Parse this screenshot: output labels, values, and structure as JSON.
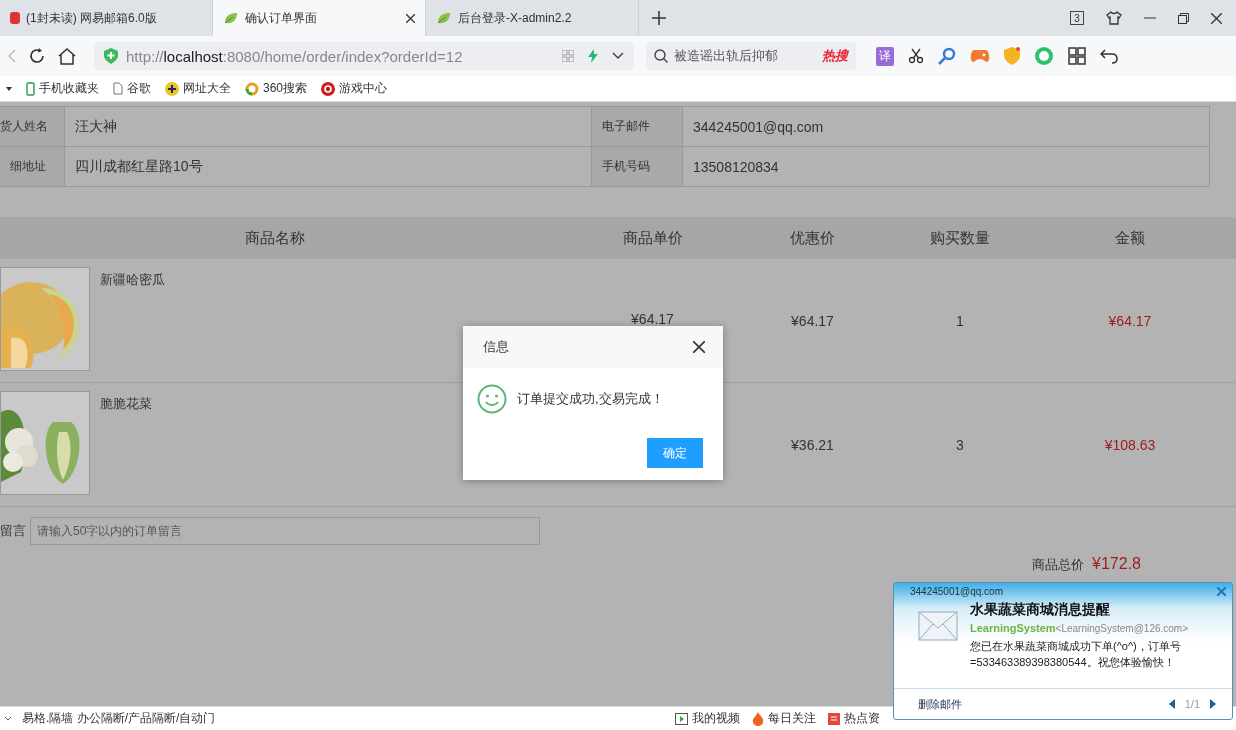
{
  "tabs": [
    {
      "label": "(1封未读) 网易邮箱6.0版",
      "kind": "mail",
      "selected": false
    },
    {
      "label": "确认订单界面",
      "kind": "leaf",
      "selected": true
    },
    {
      "label": "后台登录-X-admin2.2",
      "kind": "leaf",
      "selected": false
    }
  ],
  "tab_count": "3",
  "address_bar": {
    "scheme": "http://",
    "host": "localhost",
    "rest": ":8080/home/order/index?orderId=12"
  },
  "search": {
    "value": "被造谣出轨后抑郁",
    "hot_label": "热搜"
  },
  "translate_label": "译",
  "bookmarks": [
    {
      "label": "手机收藏夹",
      "kind": "phone"
    },
    {
      "label": "谷歌",
      "kind": "doc"
    },
    {
      "label": "网址大全",
      "kind": "plus"
    },
    {
      "label": "360搜索",
      "kind": "ring"
    },
    {
      "label": "游戏中心",
      "kind": "game"
    }
  ],
  "customer": [
    [
      {
        "label": "货人姓名",
        "value": "汪大神"
      },
      {
        "label": "电子邮件",
        "value": "344245001@qq.com"
      }
    ],
    [
      {
        "label": "细地址",
        "value": "四川成都红星路10号"
      },
      {
        "label": "手机号码",
        "value": "13508120834"
      }
    ]
  ],
  "products": {
    "columns": [
      "商品名称",
      "商品单价",
      "优惠价",
      "购买数量",
      "金额"
    ],
    "rows": [
      {
        "name": "新疆哈密瓜",
        "kind": "melon",
        "unit_price": "¥64.17",
        "discount_price": "¥64.17",
        "quantity": "1",
        "amount": "¥64.17"
      },
      {
        "name": "脆脆花菜",
        "kind": "cauliflower",
        "discount_price": "¥36.21",
        "quantity": "3",
        "amount": "¥108.63"
      }
    ]
  },
  "message": {
    "label": "留言",
    "placeholder": "请输入50字以内的订单留言"
  },
  "total": {
    "label": "商品总价",
    "value": "¥172.8"
  },
  "dialog": {
    "title": "信息",
    "message": "订单提交成功,交易完成！",
    "button": "确定"
  },
  "status_bar": {
    "left": "易格.隔墙 办公隔断/产品隔断/自动门",
    "items": [
      {
        "label": "我的视频",
        "kind": "video"
      },
      {
        "label": "每日关注",
        "kind": "fire"
      },
      {
        "label": "热点资",
        "kind": "news"
      }
    ]
  },
  "notification": {
    "account": "344245001@qq.com",
    "title": "水果蔬菜商城消息提醒",
    "sender_name": "LearningSystem",
    "sender_address": "<LearningSystem@126.com>",
    "body": "您已在水果蔬菜商城成功下单(^o^)，订单号=533463389398380544。祝您体验愉快！",
    "delete_label": "删除邮件",
    "page": "1/1"
  }
}
